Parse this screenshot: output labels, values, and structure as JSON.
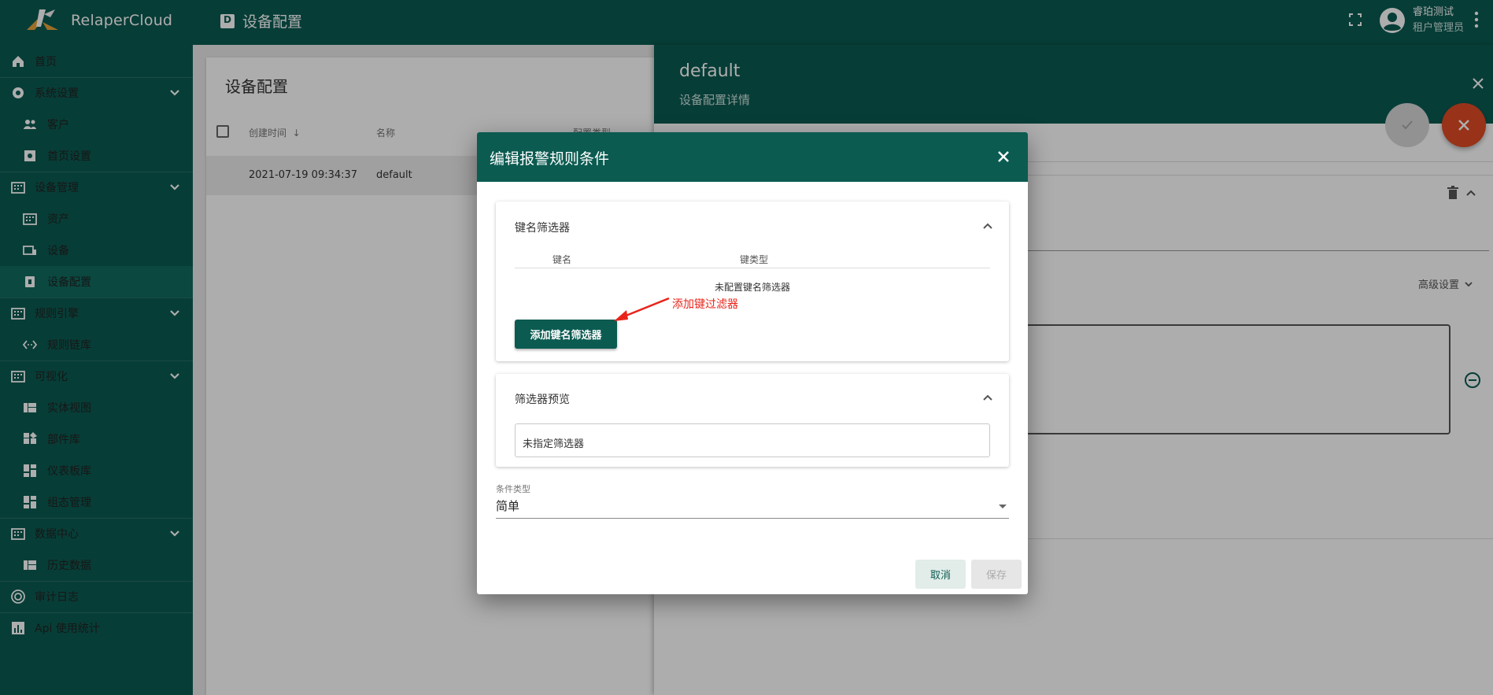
{
  "app": {
    "name": "RelaperCloud"
  },
  "header": {
    "page_title": "设备配置",
    "user_name": "睿珀测试",
    "user_role": "租户管理员",
    "fullscreen_icon": "fullscreen-icon",
    "menu_icon": "more-vert-icon"
  },
  "sidebar": {
    "items": [
      {
        "label": "首页",
        "icon": "home-icon"
      },
      {
        "label": "系统设置",
        "icon": "gear-icon",
        "expandable": true
      },
      {
        "label": "客户",
        "icon": "people-icon"
      },
      {
        "label": "首页设置",
        "icon": "settings-box-icon"
      },
      {
        "label": "设备管理",
        "icon": "building-icon",
        "expandable": true
      },
      {
        "label": "资产",
        "icon": "building-icon"
      },
      {
        "label": "设备",
        "icon": "devices-icon"
      },
      {
        "label": "设备配置",
        "icon": "device-profile-icon",
        "active": true
      },
      {
        "label": "规则引擎",
        "icon": "building-icon",
        "expandable": true
      },
      {
        "label": "规则链库",
        "icon": "code-icon"
      },
      {
        "label": "可视化",
        "icon": "building-icon",
        "expandable": true
      },
      {
        "label": "实体视图",
        "icon": "view-quilt-icon"
      },
      {
        "label": "部件库",
        "icon": "widgets-icon"
      },
      {
        "label": "仪表板库",
        "icon": "dashboard-icon"
      },
      {
        "label": "组态管理",
        "icon": "dashboard-icon"
      },
      {
        "label": "数据中心",
        "icon": "building-icon",
        "expandable": true
      },
      {
        "label": "历史数据",
        "icon": "view-quilt-icon"
      },
      {
        "label": "审计日志",
        "icon": "track-changes-icon"
      },
      {
        "label": "Api 使用统计",
        "icon": "chart-icon"
      }
    ]
  },
  "main": {
    "title": "设备配置",
    "columns": [
      "创建时间",
      "名称",
      "配置类型"
    ],
    "rows": [
      {
        "created": "2021-07-19 09:34:37",
        "name": "default"
      }
    ]
  },
  "details": {
    "title": "default",
    "subtitle": "设备配置详情",
    "advanced_label": "高级设置"
  },
  "dialog": {
    "title": "编辑报警规则条件",
    "key_filters": {
      "title": "键名筛选器",
      "col_key": "键名",
      "col_key_type": "键类型",
      "empty_text": "未配置键名筛选器",
      "add_button": "添加键名筛选器"
    },
    "annotation": "添加键过滤器",
    "preview": {
      "title": "筛选器预览",
      "value": "未指定筛选器"
    },
    "condition_type": {
      "label": "条件类型",
      "value": "简单"
    },
    "cancel_label": "取消",
    "save_label": "保存"
  },
  "colors": {
    "primary": "#0b5b51",
    "accent_red": "#e04a24",
    "annotation_red": "#e8241a"
  }
}
